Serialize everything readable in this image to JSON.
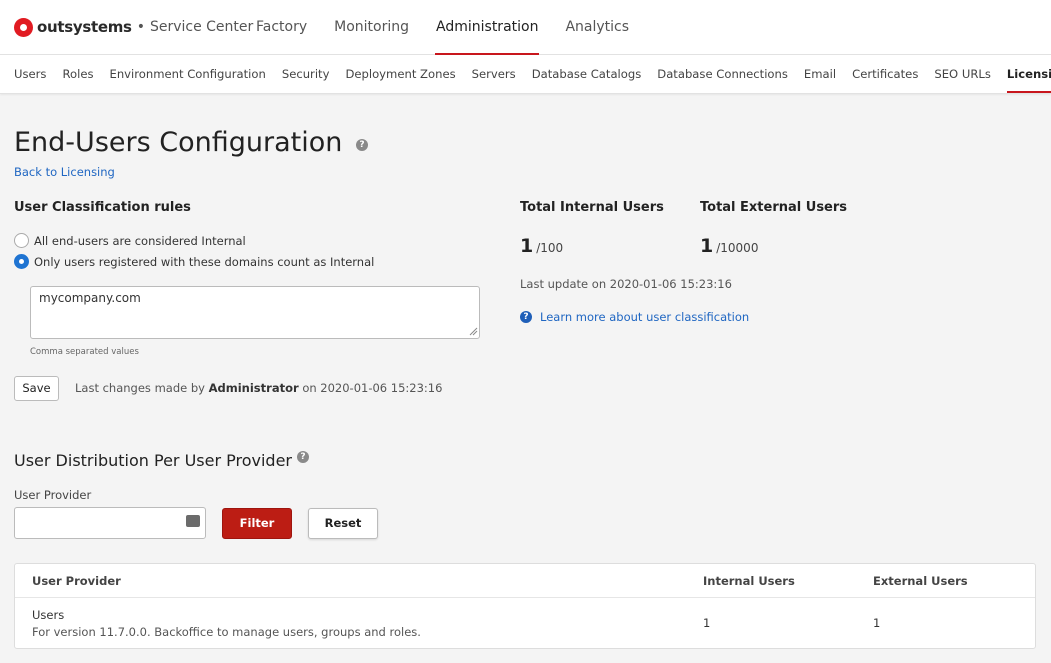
{
  "brand": {
    "name": "outsystems",
    "separator": "•",
    "product": "Service Center"
  },
  "main_nav": [
    {
      "label": "Factory",
      "active": false
    },
    {
      "label": "Monitoring",
      "active": false
    },
    {
      "label": "Administration",
      "active": true
    },
    {
      "label": "Analytics",
      "active": false
    }
  ],
  "sub_nav": [
    {
      "label": "Users"
    },
    {
      "label": "Roles"
    },
    {
      "label": "Environment Configuration"
    },
    {
      "label": "Security"
    },
    {
      "label": "Deployment Zones"
    },
    {
      "label": "Servers"
    },
    {
      "label": "Database Catalogs"
    },
    {
      "label": "Database Connections"
    },
    {
      "label": "Email"
    },
    {
      "label": "Certificates"
    },
    {
      "label": "SEO URLs"
    },
    {
      "label": "Licensing",
      "active": true
    }
  ],
  "page": {
    "title": "End-Users Configuration",
    "back_link": "Back to Licensing"
  },
  "classification": {
    "title": "User Classification rules",
    "options": [
      {
        "label": "All end-users are considered Internal",
        "checked": false
      },
      {
        "label": "Only users registered with these domains count as Internal",
        "checked": true
      }
    ],
    "domains_value": "mycompany.com",
    "helper": "Comma separated values",
    "save_label": "Save",
    "last_changes": {
      "prefix": "Last changes made by",
      "user": "Administrator",
      "suffix": "on 2020-01-06 15:23:16"
    }
  },
  "stats": {
    "internal": {
      "label": "Total Internal Users",
      "value": "1",
      "max": "/100"
    },
    "external": {
      "label": "Total External Users",
      "value": "1",
      "max": "/10000"
    },
    "last_update": "Last update on 2020-01-06 15:23:16",
    "learn_more": "Learn more about user classification"
  },
  "distribution": {
    "title": "User Distribution Per User Provider",
    "field_label": "User Provider",
    "input_value": "",
    "filter_label": "Filter",
    "reset_label": "Reset",
    "columns": [
      "User Provider",
      "Internal Users",
      "External Users"
    ],
    "rows": [
      {
        "name": "Users",
        "description": "For version 11.7.0.0. Backoffice to manage users, groups and roles.",
        "internal": "1",
        "external": "1"
      }
    ]
  },
  "colors": {
    "accent": "#c8161d",
    "link": "#1f66c2",
    "filter_button": "#bc1d14"
  }
}
